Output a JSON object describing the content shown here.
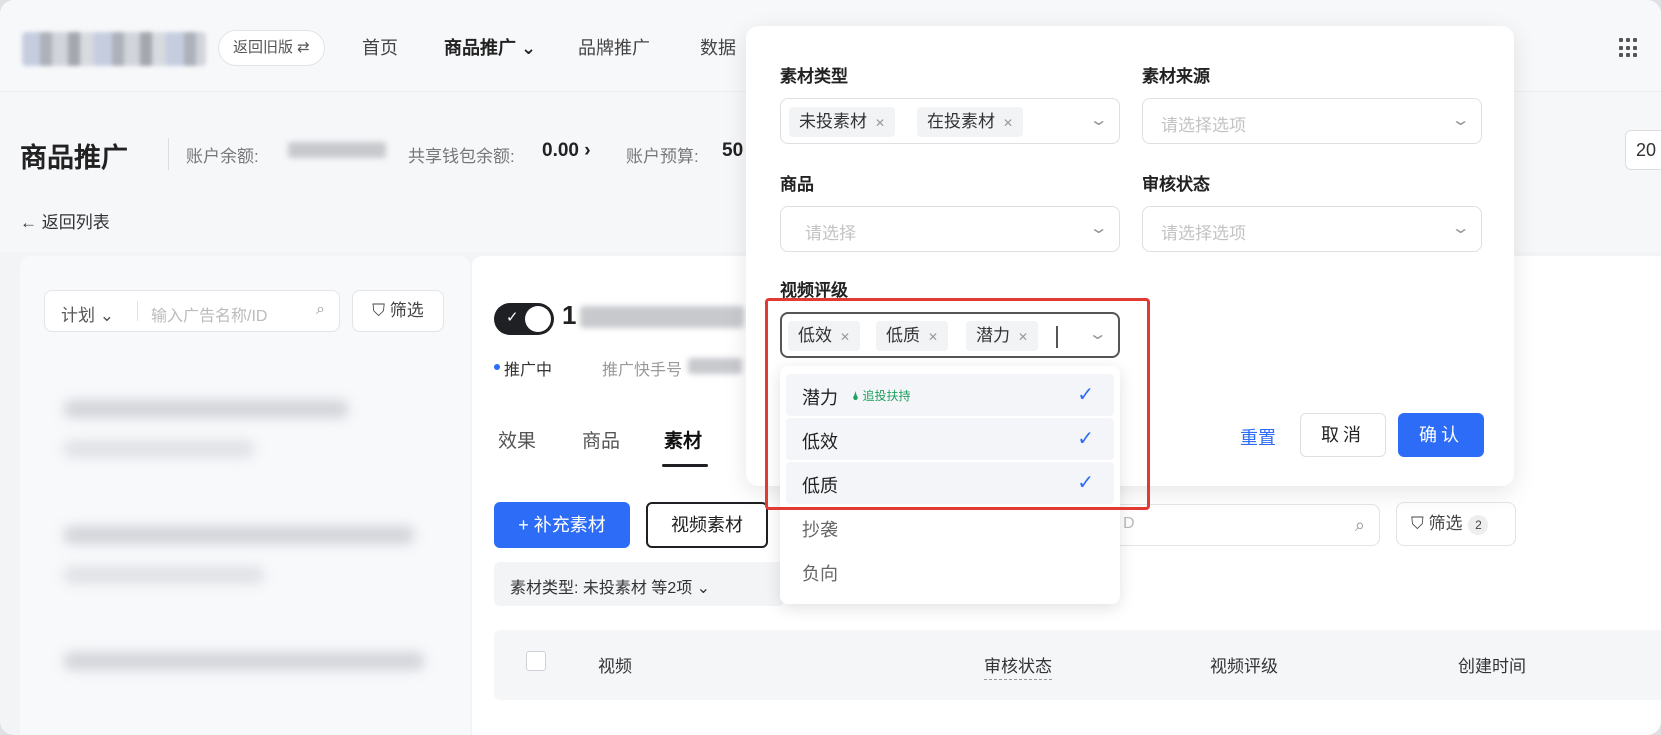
{
  "topbar": {
    "old_version_button": "返回旧版 ⇄",
    "nav": [
      "首页",
      "商品推广 ⌄",
      "品牌推广",
      "数据"
    ]
  },
  "header": {
    "page_title": "商品推广",
    "balance_label": "账户余额:",
    "wallet_label": "共享钱包余额:",
    "wallet_value": "0.00 ›",
    "budget_label": "账户预算:",
    "budget_value": "50",
    "back_link": "← 返回列表",
    "date_partial": "20"
  },
  "left_panel": {
    "plan_select": "计划 ⌄",
    "search_placeholder": "输入广告名称/ID",
    "filter_button": "筛选"
  },
  "main": {
    "ad_name_partial": "1",
    "status": "推广中",
    "kuaishou_label": "推广快手号",
    "tabs": [
      "效果",
      "商品",
      "素材"
    ],
    "add_material_button": "+ 补充素材",
    "video_material_button": "视频素材",
    "search_placeholder_partial": "D",
    "filter_button": "筛选",
    "filter_count": "2",
    "filter_chip": "素材类型: 未投素材 等2项  ⌄",
    "table_headers": [
      "视频",
      "审核状态",
      "视频评级",
      "创建时间"
    ]
  },
  "popover": {
    "material_type_label": "素材类型",
    "material_type_tags": [
      "未投素材",
      "在投素材"
    ],
    "material_source_label": "素材来源",
    "material_source_placeholder": "请选择选项",
    "product_label": "商品",
    "product_placeholder": "请选择",
    "review_status_label": "审核状态",
    "review_status_placeholder": "请选择选项",
    "video_rating_label": "视频评级",
    "video_rating_tags": [
      "低效",
      "低质",
      "潜力"
    ],
    "reset": "重置",
    "cancel": "取消",
    "confirm": "确认"
  },
  "dropdown": {
    "options": [
      {
        "label": "潜力",
        "hint": "🌢 追投扶持",
        "selected": true
      },
      {
        "label": "低效",
        "hint": "",
        "selected": true
      },
      {
        "label": "低质",
        "hint": "",
        "selected": true
      },
      {
        "label": "抄袭",
        "hint": "",
        "selected": false
      },
      {
        "label": "负向",
        "hint": "",
        "selected": false
      }
    ]
  },
  "colors": {
    "accent": "#2d6cf6",
    "highlight_border": "#e23a32",
    "hint_green": "#1fa15f"
  }
}
